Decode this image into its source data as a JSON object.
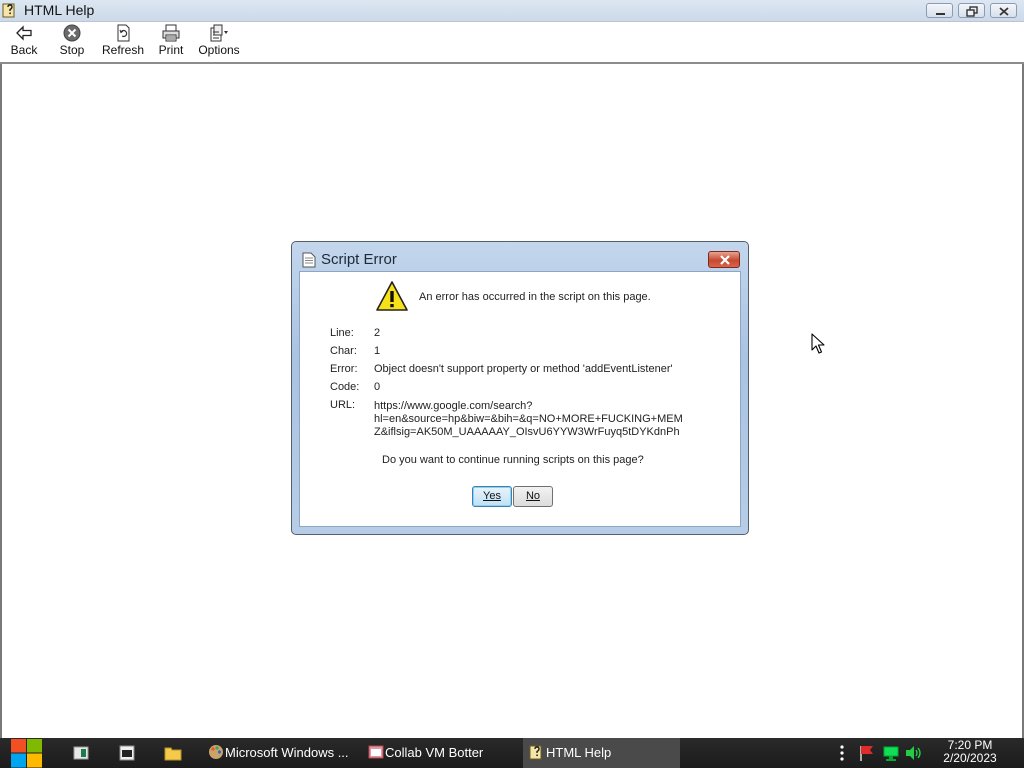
{
  "window": {
    "title": "HTML Help"
  },
  "toolbar": {
    "back": "Back",
    "stop": "Stop",
    "refresh": "Refresh",
    "print": "Print",
    "options": "Options"
  },
  "dialog": {
    "title": "Script Error",
    "message": "An error has occurred in the script on this page.",
    "fields": {
      "line_label": "Line:",
      "line_value": "2",
      "char_label": "Char:",
      "char_value": "1",
      "error_label": "Error:",
      "error_value": "Object doesn't support property or method 'addEventListener'",
      "code_label": "Code:",
      "code_value": "0",
      "url_label": "URL:",
      "url_lines": [
        "https://www.google.com/search?",
        "hl=en&source=hp&biw=&bih=&q=NO+MORE+FUCKING+MEM",
        "Z&iflsig=AK50M_UAAAAAY_OIsvU6YYW3WrFuyq5tDYKdnPh"
      ]
    },
    "question": "Do you want to continue running scripts on this page?",
    "yes_button": "Yes",
    "no_button": "No"
  },
  "taskbar": {
    "tasks": [
      {
        "label": "Microsoft Windows ...",
        "icon": "paint-palette-icon"
      },
      {
        "label": "Collab VM Botter",
        "icon": "app-window-icon"
      },
      {
        "label": "HTML Help",
        "icon": "html-help-icon",
        "active": true
      }
    ],
    "clock": {
      "time": "7:20 PM",
      "date": "2/20/2023"
    }
  },
  "colors": {
    "taskbar": "#1b1b1b",
    "dialog_frame": "#a9c3e2",
    "close_red": "#c64a32",
    "yes_focus": "#3c7fb1"
  }
}
